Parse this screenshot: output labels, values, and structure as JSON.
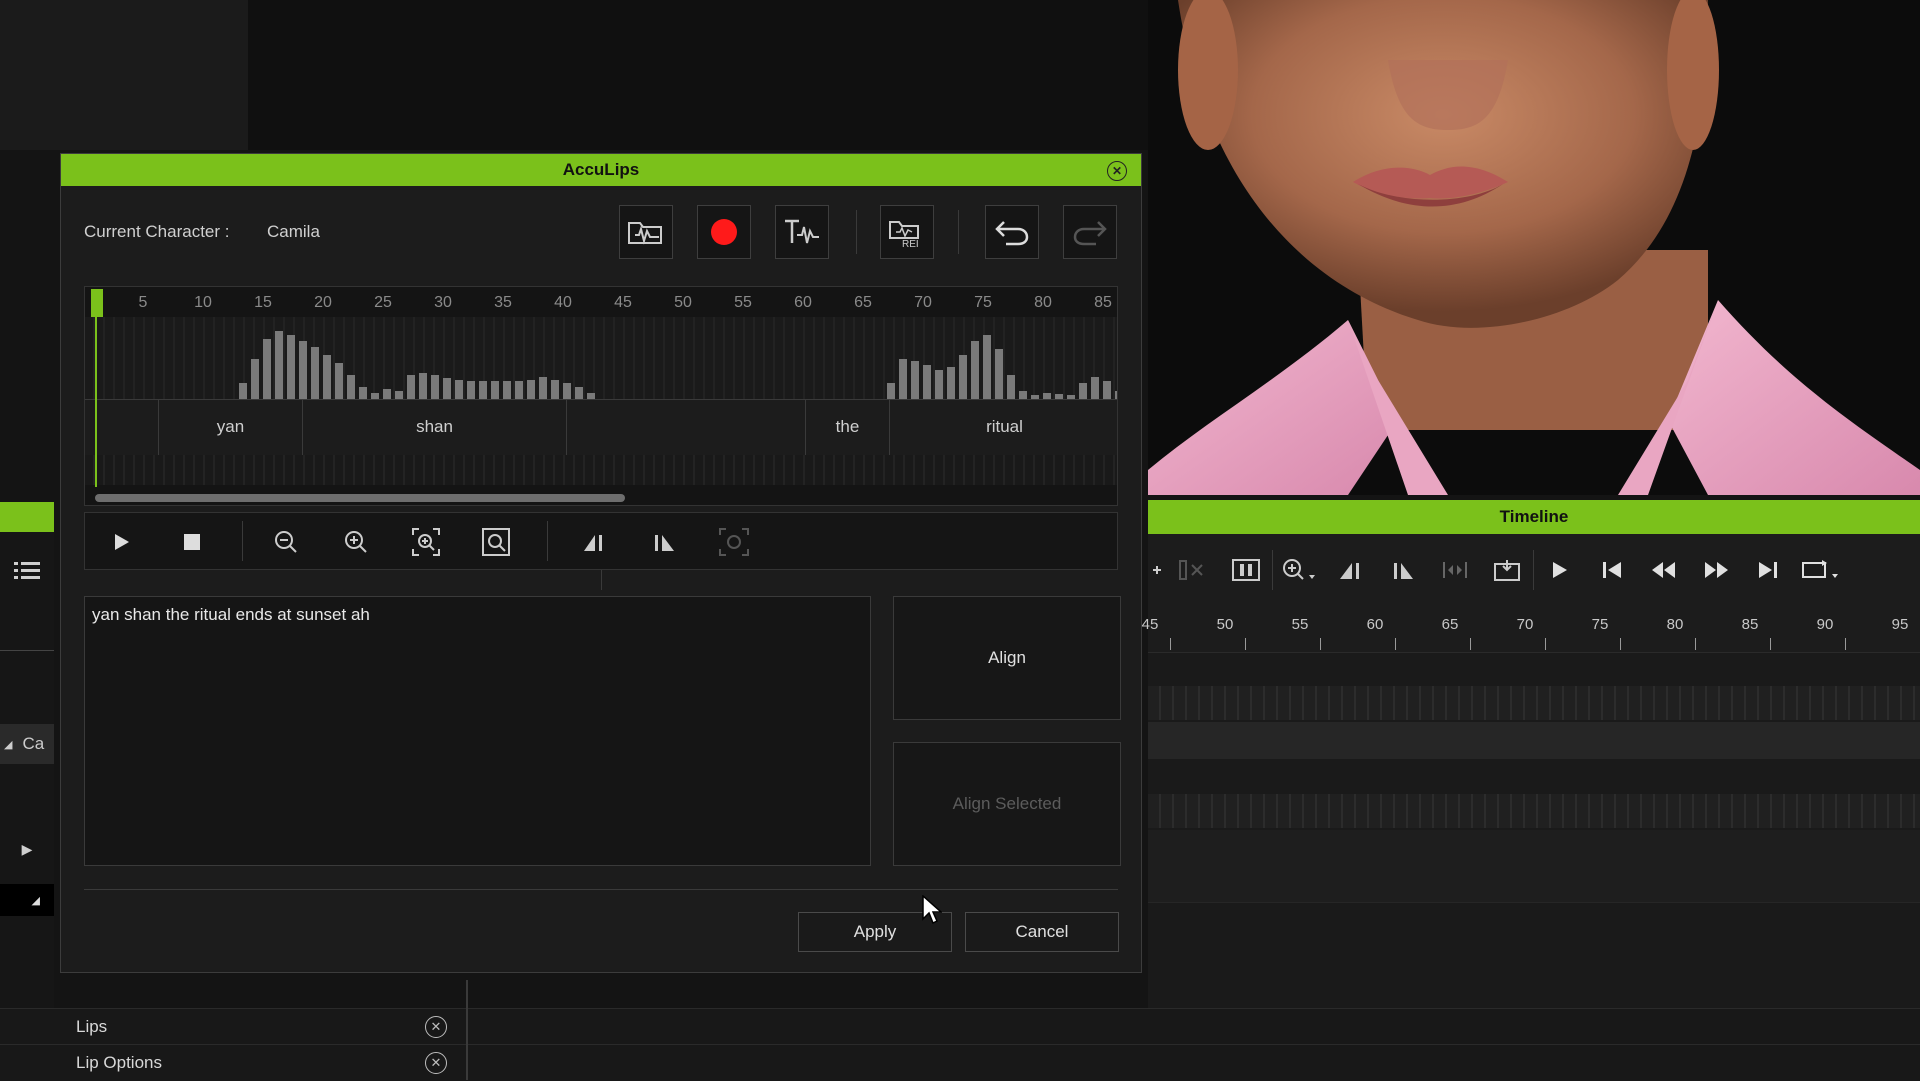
{
  "dialog": {
    "title": "AccuLips",
    "current_character_label": "Current Character :",
    "current_character_value": "Camila",
    "toolbar_icons": [
      "open-audio-icon",
      "record-icon",
      "text-to-speech-icon",
      "open-script-icon",
      "undo-icon",
      "redo-icon"
    ],
    "ruler_ticks": [
      "5",
      "10",
      "15",
      "20",
      "25",
      "30",
      "35",
      "40",
      "45",
      "50",
      "55",
      "60",
      "65",
      "70",
      "75",
      "80",
      "85"
    ],
    "words": [
      "yan",
      "shan",
      "the",
      "ritual"
    ],
    "script_text": "yan shan the ritual ends at sunset ah",
    "align_button": "Align",
    "align_selected_button": "Align Selected",
    "apply_button": "Apply",
    "cancel_button": "Cancel"
  },
  "timeline": {
    "title": "Timeline",
    "ruler_ticks": [
      "45",
      "50",
      "55",
      "60",
      "65",
      "70",
      "75",
      "80",
      "85",
      "90",
      "95"
    ]
  },
  "left_panel": {
    "collapsed_label": "Ca"
  },
  "bottom_rows": [
    {
      "label": "Lips"
    },
    {
      "label": "Lip Options"
    }
  ],
  "colors": {
    "accent_green": "#7bc11b",
    "record_red": "#ff1a1a"
  }
}
